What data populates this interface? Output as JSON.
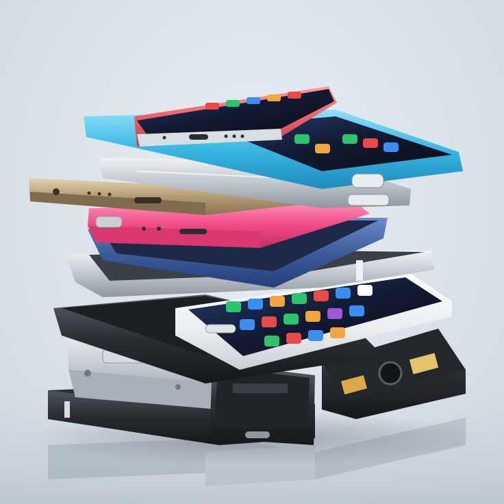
{
  "image": {
    "subject": "stack-of-smartphones",
    "colors": {
      "background": "#dde4ea",
      "cyan": "#4fc3e8",
      "coral": "#f06a72",
      "pink": "#f2508a",
      "gold": "#b8a37e",
      "navy": "#2f4a86",
      "silver": "#c8ced4",
      "white": "#f4f6f8",
      "black": "#1f2226",
      "screen": "#10131a"
    }
  }
}
